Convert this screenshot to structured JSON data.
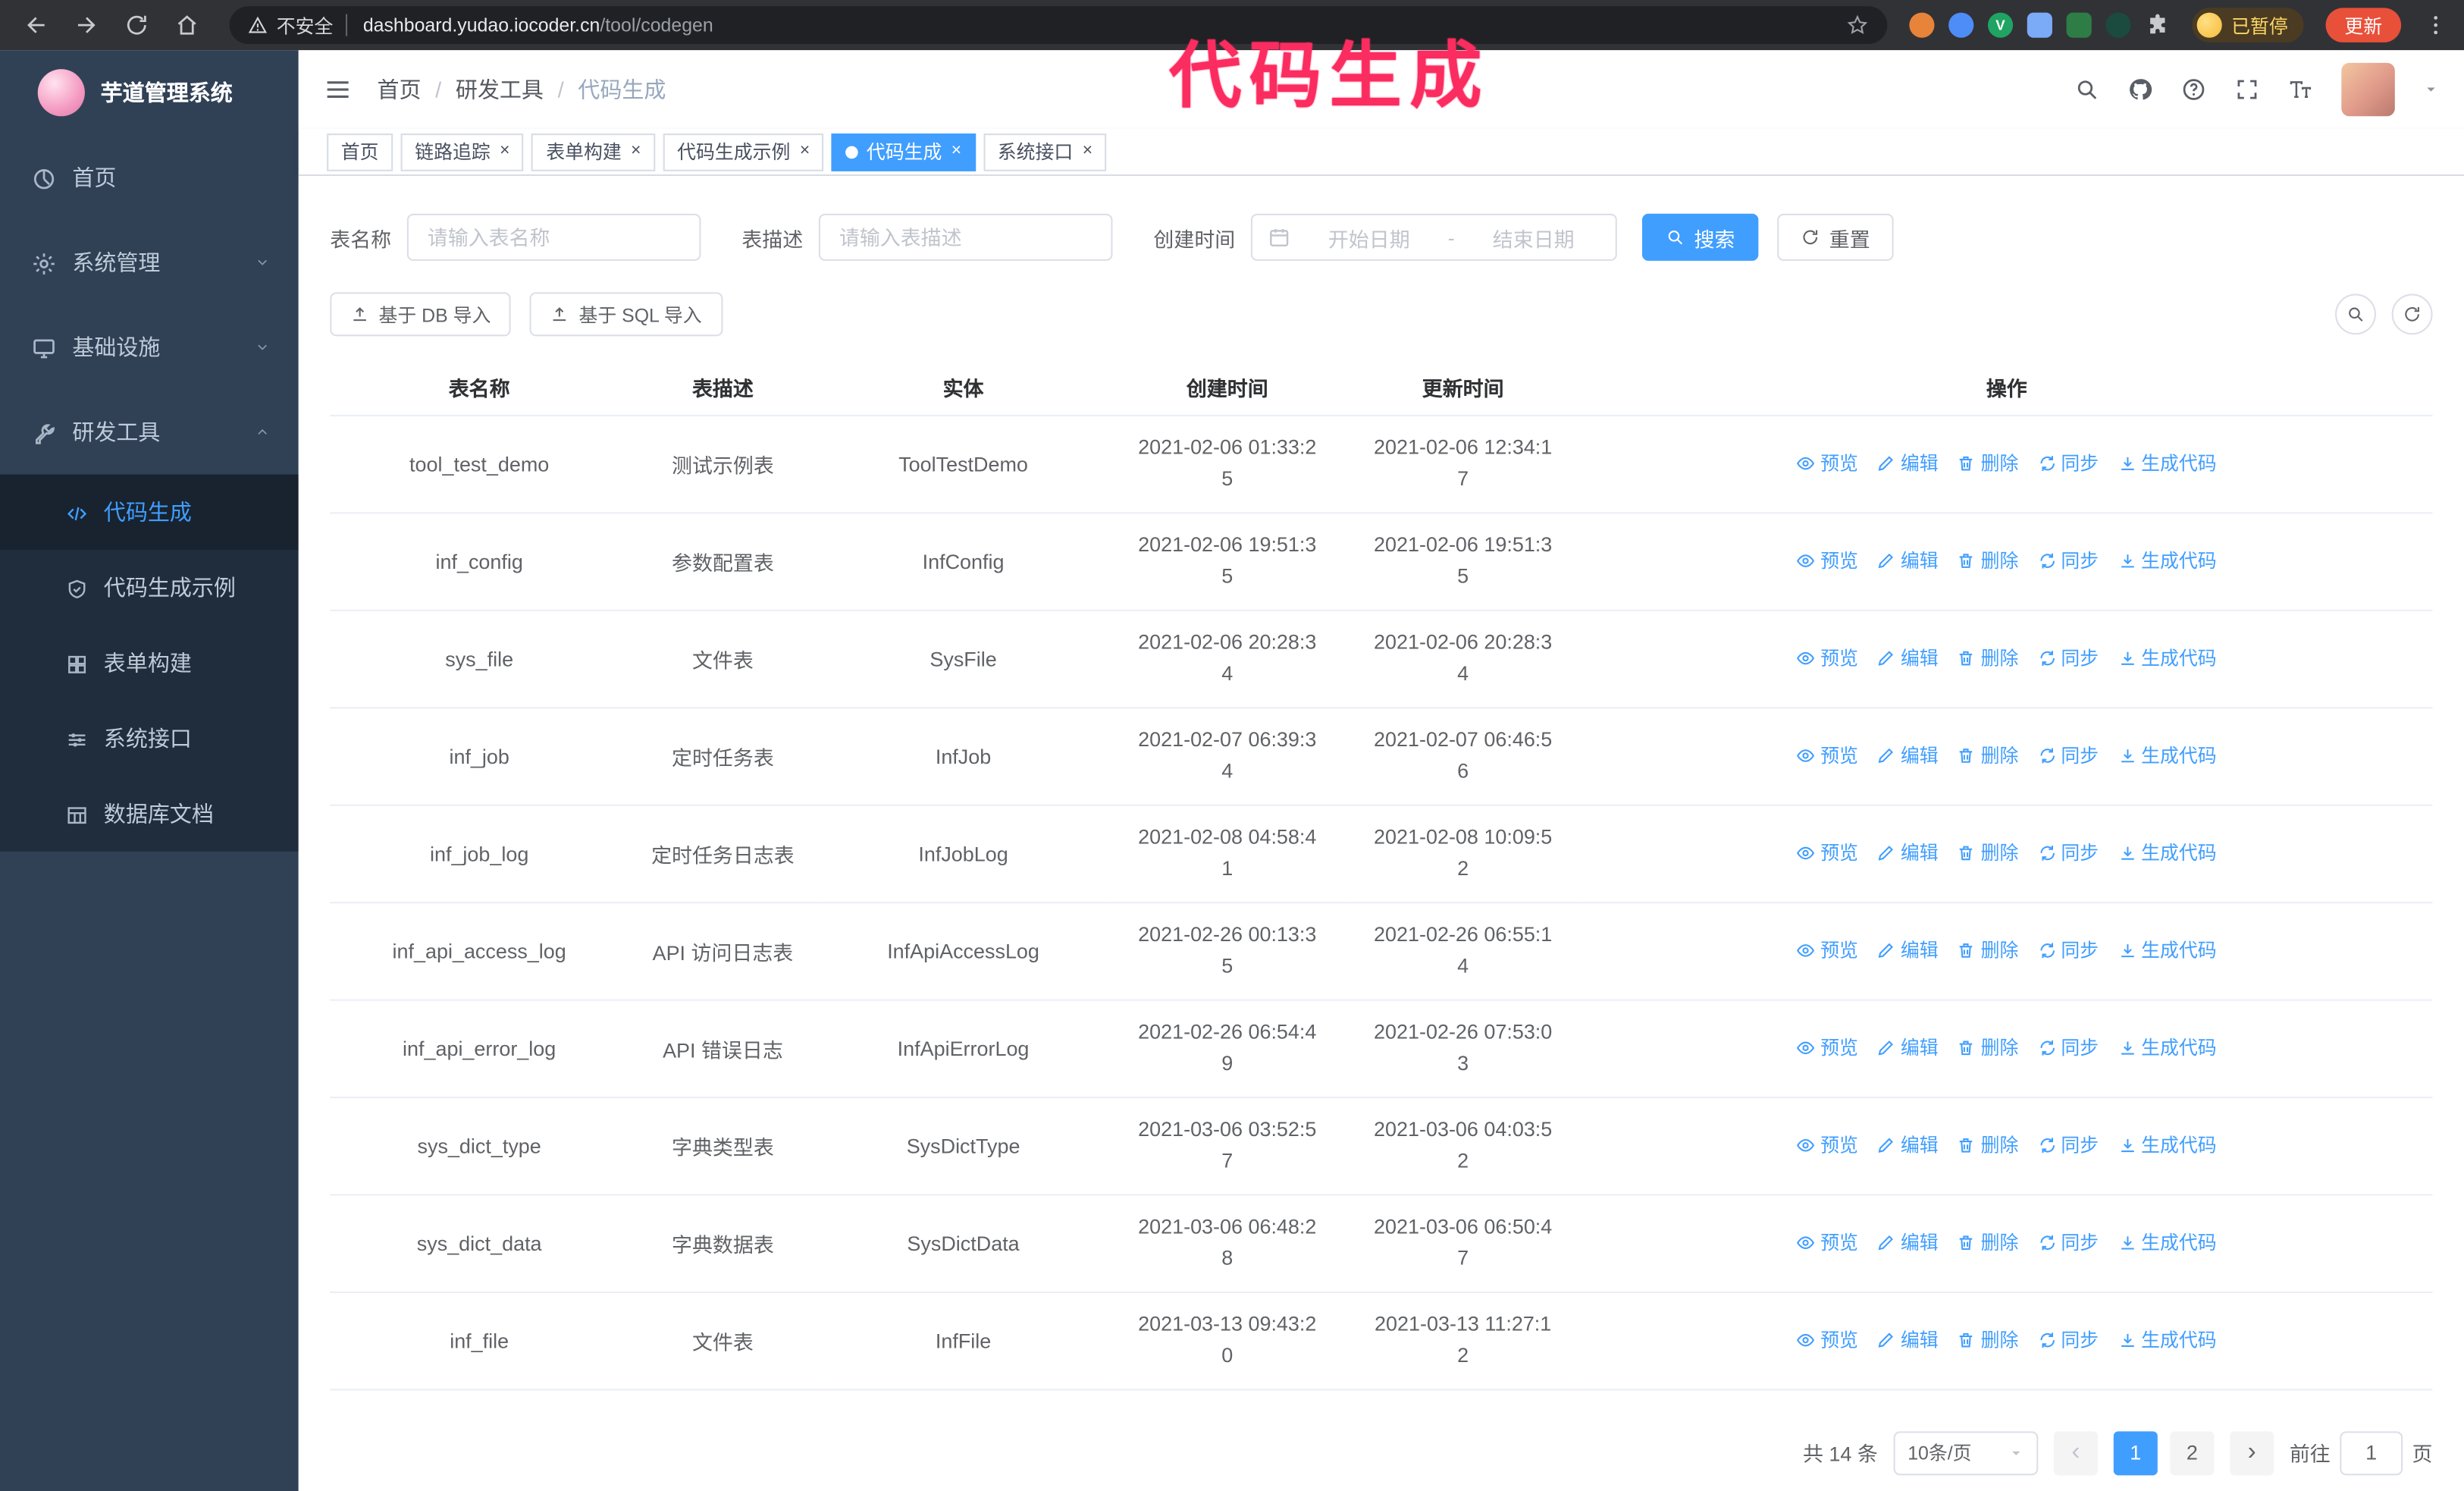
{
  "annotation": {
    "text": "代码生成",
    "color": "#fb2c60"
  },
  "browser": {
    "security_label": "不安全",
    "url_domain": "dashboard.yudao.iocoder.cn",
    "url_path": "/tool/codegen",
    "profile_badge": "已暂停",
    "update_button": "更新",
    "extensions": [
      {
        "name": "extension-icon",
        "color": "#e8833a",
        "shape": "circle",
        "glyph": ""
      },
      {
        "name": "extension-icon",
        "color": "#4e8cf7",
        "shape": "circle",
        "glyph": ""
      },
      {
        "name": "extension-icon",
        "color": "#1fa463",
        "shape": "circle",
        "glyph": "V"
      },
      {
        "name": "extension-icon",
        "color": "#7baaf7",
        "shape": "square",
        "glyph": ""
      },
      {
        "name": "extension-icon",
        "color": "#2e7d46",
        "shape": "square",
        "glyph": ""
      },
      {
        "name": "extension-icon",
        "color": "#1b4a3e",
        "shape": "circle",
        "glyph": ""
      },
      {
        "name": "puzzle-icon",
        "color": "#c8cacd",
        "shape": "puzzle",
        "glyph": ""
      }
    ]
  },
  "sidebar": {
    "logo_title": "芋道管理系统",
    "menu": [
      {
        "label": "首页",
        "icon": "dashboard-icon",
        "chevron": null,
        "submenu_open": false
      },
      {
        "label": "系统管理",
        "icon": "gear-icon",
        "chevron": "down",
        "submenu_open": false
      },
      {
        "label": "基础设施",
        "icon": "monitor-icon",
        "chevron": "down",
        "submenu_open": false
      },
      {
        "label": "研发工具",
        "icon": "wrench-icon",
        "chevron": "up",
        "submenu_open": true
      }
    ],
    "submenu": [
      {
        "label": "代码生成",
        "icon": "code-icon",
        "active": true
      },
      {
        "label": "代码生成示例",
        "icon": "shield-icon",
        "active": false
      },
      {
        "label": "表单构建",
        "icon": "grid-icon",
        "active": false
      },
      {
        "label": "系统接口",
        "icon": "sliders-icon",
        "active": false
      },
      {
        "label": "数据库文档",
        "icon": "table-icon",
        "active": false
      }
    ]
  },
  "breadcrumb": [
    "首页",
    "研发工具",
    "代码生成"
  ],
  "tags": [
    {
      "label": "首页",
      "closable": false,
      "active": false
    },
    {
      "label": "链路追踪",
      "closable": true,
      "active": false
    },
    {
      "label": "表单构建",
      "closable": true,
      "active": false
    },
    {
      "label": "代码生成示例",
      "closable": true,
      "active": false
    },
    {
      "label": "代码生成",
      "closable": true,
      "active": true
    },
    {
      "label": "系统接口",
      "closable": true,
      "active": false
    }
  ],
  "filters": {
    "table_name_label": "表名称",
    "table_name_placeholder": "请输入表名称",
    "table_desc_label": "表描述",
    "table_desc_placeholder": "请输入表描述",
    "create_time_label": "创建时间",
    "date_start_placeholder": "开始日期",
    "date_separator": "-",
    "date_end_placeholder": "结束日期",
    "search_button": "搜索",
    "reset_button": "重置"
  },
  "toolbar": {
    "import_db_button": "基于 DB 导入",
    "import_sql_button": "基于 SQL 导入"
  },
  "table": {
    "columns": [
      "表名称",
      "表描述",
      "实体",
      "创建时间",
      "更新时间",
      "操作"
    ],
    "row_actions": [
      {
        "key": "preview",
        "label": "预览",
        "icon": "eye-icon"
      },
      {
        "key": "edit",
        "label": "编辑",
        "icon": "edit-icon"
      },
      {
        "key": "delete",
        "label": "删除",
        "icon": "delete-icon"
      },
      {
        "key": "sync",
        "label": "同步",
        "icon": "sync-icon"
      },
      {
        "key": "generate-code",
        "label": "生成代码",
        "icon": "download-icon"
      }
    ],
    "rows": [
      {
        "name": "tool_test_demo",
        "desc": "测试示例表",
        "entity": "ToolTestDemo",
        "created": "2021-02-06 01:33:25",
        "updated": "2021-02-06 12:34:17"
      },
      {
        "name": "inf_config",
        "desc": "参数配置表",
        "entity": "InfConfig",
        "created": "2021-02-06 19:51:35",
        "updated": "2021-02-06 19:51:35"
      },
      {
        "name": "sys_file",
        "desc": "文件表",
        "entity": "SysFile",
        "created": "2021-02-06 20:28:34",
        "updated": "2021-02-06 20:28:34"
      },
      {
        "name": "inf_job",
        "desc": "定时任务表",
        "entity": "InfJob",
        "created": "2021-02-07 06:39:34",
        "updated": "2021-02-07 06:46:56"
      },
      {
        "name": "inf_job_log",
        "desc": "定时任务日志表",
        "entity": "InfJobLog",
        "created": "2021-02-08 04:58:41",
        "updated": "2021-02-08 10:09:52"
      },
      {
        "name": "inf_api_access_log",
        "desc": "API 访问日志表",
        "entity": "InfApiAccessLog",
        "created": "2021-02-26 00:13:35",
        "updated": "2021-02-26 06:55:14"
      },
      {
        "name": "inf_api_error_log",
        "desc": "API 错误日志",
        "entity": "InfApiErrorLog",
        "created": "2021-02-26 06:54:49",
        "updated": "2021-02-26 07:53:03"
      },
      {
        "name": "sys_dict_type",
        "desc": "字典类型表",
        "entity": "SysDictType",
        "created": "2021-03-06 03:52:57",
        "updated": "2021-03-06 04:03:52"
      },
      {
        "name": "sys_dict_data",
        "desc": "字典数据表",
        "entity": "SysDictData",
        "created": "2021-03-06 06:48:28",
        "updated": "2021-03-06 06:50:47"
      },
      {
        "name": "inf_file",
        "desc": "文件表",
        "entity": "InfFile",
        "created": "2021-03-13 09:43:20",
        "updated": "2021-03-13 11:27:12"
      }
    ]
  },
  "pagination": {
    "total": "共 14 条",
    "page_size": "10条/页",
    "pages": [
      {
        "label": "1",
        "active": true
      },
      {
        "label": "2",
        "active": false
      }
    ],
    "goto_label": "前往",
    "goto_value": "1",
    "goto_unit": "页"
  },
  "colors": {
    "primary": "#409eff",
    "sidebar_bg": "#304156",
    "submenu_bg": "#1f2d3d",
    "annotation": "#fb2c60",
    "chrome_bg": "#313236",
    "update_pill": "#e8503a"
  }
}
